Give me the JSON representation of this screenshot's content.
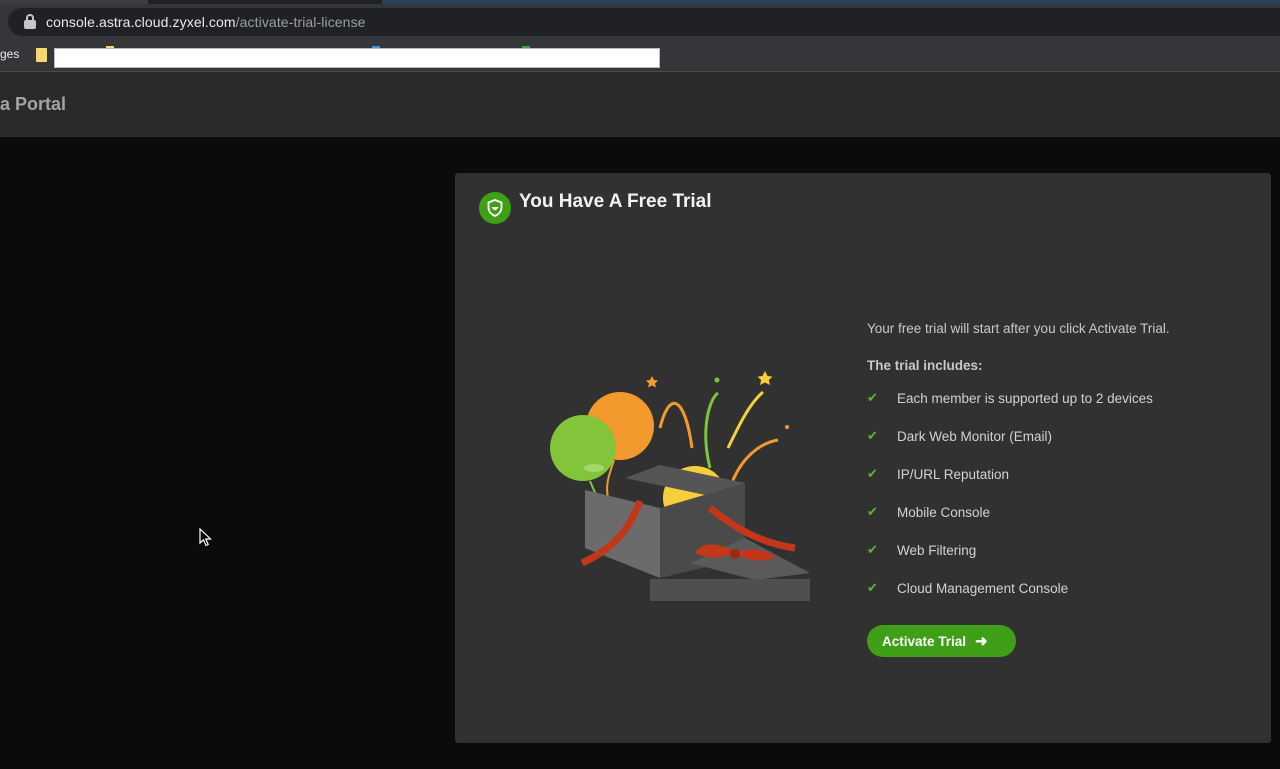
{
  "browser": {
    "url_host": "console.astra.cloud.zyxel.com",
    "url_path": "/activate-trial-license",
    "bookmarks_text": "ges",
    "lock_icon": "lock-icon",
    "folder_icon": "folder-icon"
  },
  "header": {
    "title": "a Portal"
  },
  "card": {
    "icon": "shield-icon",
    "title": "You Have A Free Trial",
    "intro": "Your free trial will start after you click Activate Trial.",
    "includes_label": "The trial includes:",
    "features": [
      "Each member is supported up to 2 devices",
      "Dark Web Monitor (Email)",
      "IP/URL Reputation",
      "Mobile Console",
      "Web Filtering",
      "Cloud Management Console"
    ],
    "check_glyph": "✔",
    "button_label": "Activate Trial",
    "button_arrow": "➜"
  },
  "colors": {
    "accent": "#3f9f17",
    "check": "#5cb82a",
    "card_bg": "#313131",
    "page_bg": "#0b0b0b"
  }
}
